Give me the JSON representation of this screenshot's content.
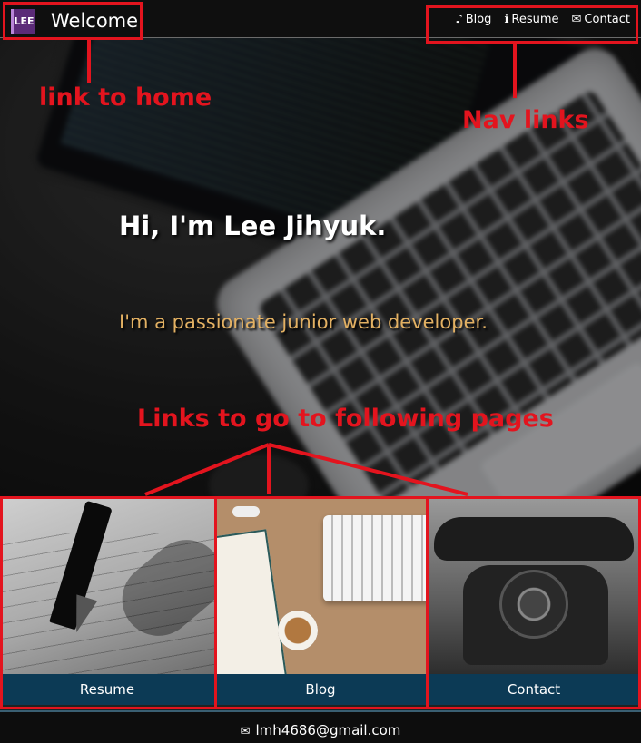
{
  "header": {
    "logo_text": "LEE",
    "home_title": "Welcome",
    "nav": [
      {
        "icon": "music-note-icon",
        "glyph": "♪",
        "label": "Blog"
      },
      {
        "icon": "info-icon",
        "glyph": "ℹ",
        "label": "Resume"
      },
      {
        "icon": "envelope-icon",
        "glyph": "✉",
        "label": "Contact"
      }
    ]
  },
  "hero": {
    "title": "Hi, I'm Lee Jihyuk.",
    "subtitle": "I'm a passionate junior web developer."
  },
  "cards": [
    {
      "label": "Resume"
    },
    {
      "label": "Blog"
    },
    {
      "label": "Contact"
    }
  ],
  "footer": {
    "icon": "envelope-icon",
    "email": "lmh4686@gmail.com"
  },
  "annotations": {
    "link_to_home": "link to home",
    "nav_links": "Nav links",
    "links_to_pages": "Links to go to following pages"
  },
  "colors": {
    "accent_red": "#e3141e",
    "subtitle_gold": "#e3b163",
    "card_label_bg": "#0c3a55",
    "logo_purple": "#5b2b78"
  }
}
